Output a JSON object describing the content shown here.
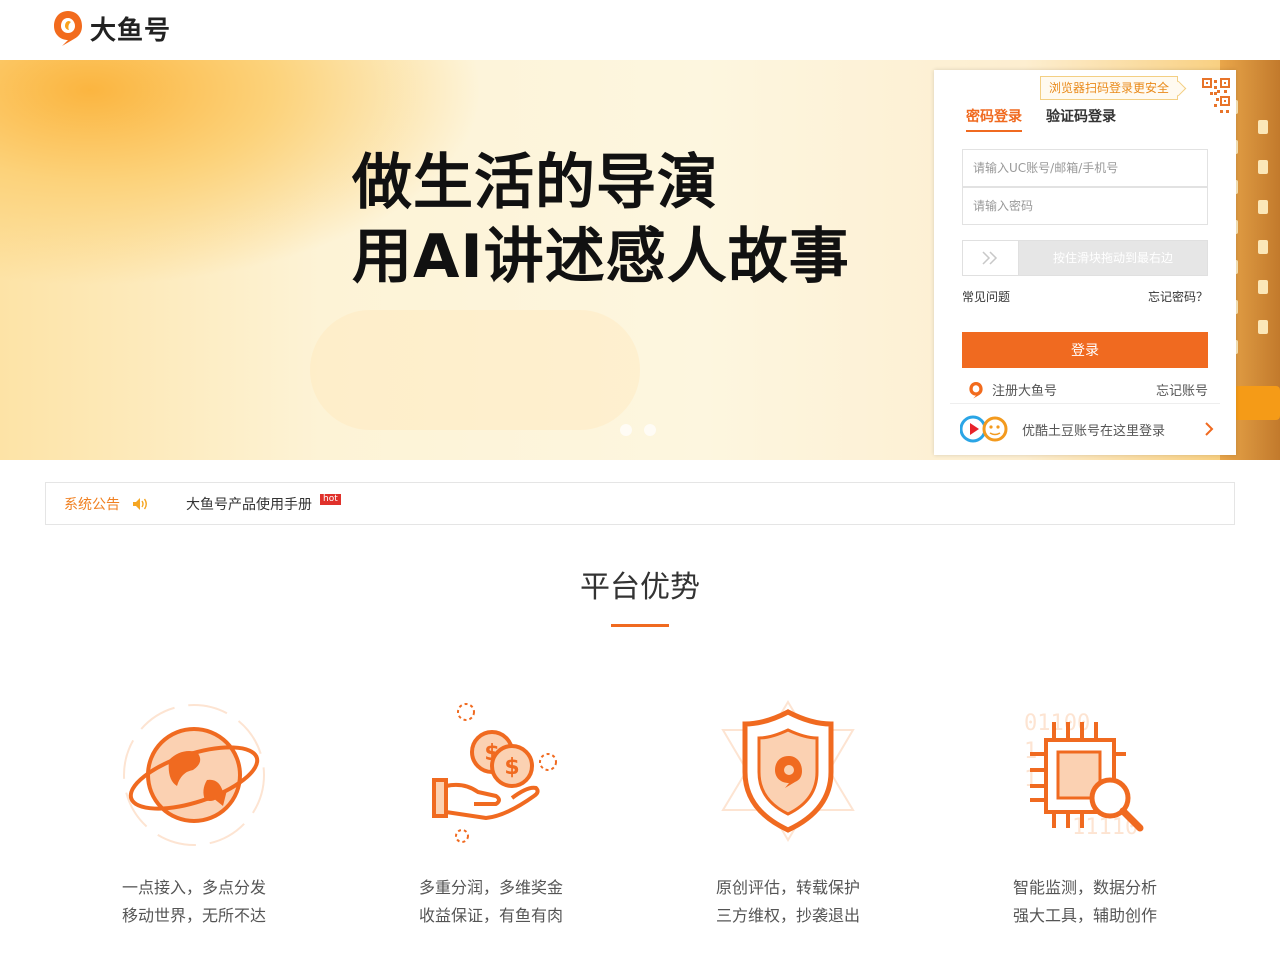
{
  "header": {
    "logo_text": "大鱼号"
  },
  "banner": {
    "line1": "做生活的导演",
    "line2": "用AI讲述感人故事"
  },
  "login": {
    "qr_tip": "浏览器扫码登录更安全",
    "tabs": [
      {
        "label": "密码登录",
        "active": true
      },
      {
        "label": "验证码登录",
        "active": false
      }
    ],
    "account_placeholder": "请输入UC账号/邮箱/手机号",
    "password_placeholder": "请输入密码",
    "slider_text": "按住滑块拖动到最右边",
    "faq": "常见问题",
    "forgot_password": "忘记密码？",
    "login_button": "登录",
    "register": "注册大鱼号",
    "forgot_account": "忘记账号",
    "youku_login": "优酷土豆账号在这里登录"
  },
  "notice": {
    "label": "系统公告",
    "link": "大鱼号产品使用手册",
    "badge": "hot"
  },
  "advantages": {
    "title": "平台优势",
    "items": [
      {
        "icon": "globe-icon",
        "line1": "一点接入，多点分发",
        "line2": "移动世界，无所不达"
      },
      {
        "icon": "coins-hand-icon",
        "line1": "多重分润，多维奖金",
        "line2": "收益保证，有鱼有肉"
      },
      {
        "icon": "shield-icon",
        "line1": "原创评估，转载保护",
        "line2": "三方维权，抄袭退出"
      },
      {
        "icon": "chip-search-icon",
        "line1": "智能监测，数据分析",
        "line2": "强大工具，辅助创作"
      }
    ]
  },
  "colors": {
    "accent": "#f06a20",
    "notice": "#f08021"
  }
}
